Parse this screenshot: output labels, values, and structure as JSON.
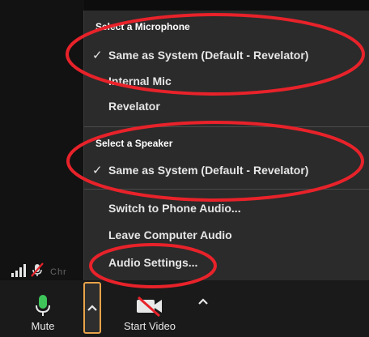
{
  "participant": {
    "name_fragment": "Chr"
  },
  "audio_menu": {
    "microphone_heading": "Select a Microphone",
    "microphones": [
      {
        "label": "Same as System (Default - Revelator)",
        "selected": true
      },
      {
        "label": "Internal Mic",
        "selected": false
      },
      {
        "label": "Revelator",
        "selected": false
      }
    ],
    "speaker_heading": "Select a Speaker",
    "speakers": [
      {
        "label": "Same as System (Default - Revelator)",
        "selected": true
      }
    ],
    "actions": [
      {
        "label": "Switch to Phone Audio..."
      },
      {
        "label": "Leave Computer Audio"
      },
      {
        "label": "Audio Settings..."
      }
    ],
    "check_glyph": "✓"
  },
  "toolbar": {
    "mute_label": "Mute",
    "start_video_label": "Start Video"
  },
  "colors": {
    "annotation_red": "#e8222a",
    "caret_highlight": "#e8a34a",
    "mic_green": "#3fc45a"
  },
  "icons": {
    "mute": "microphone-icon",
    "audio_options": "chevron-up-icon",
    "video": "video-camera-off-icon",
    "video_options": "chevron-up-icon",
    "signal": "signal-strength-icon",
    "participant_muted": "microphone-muted-icon"
  }
}
